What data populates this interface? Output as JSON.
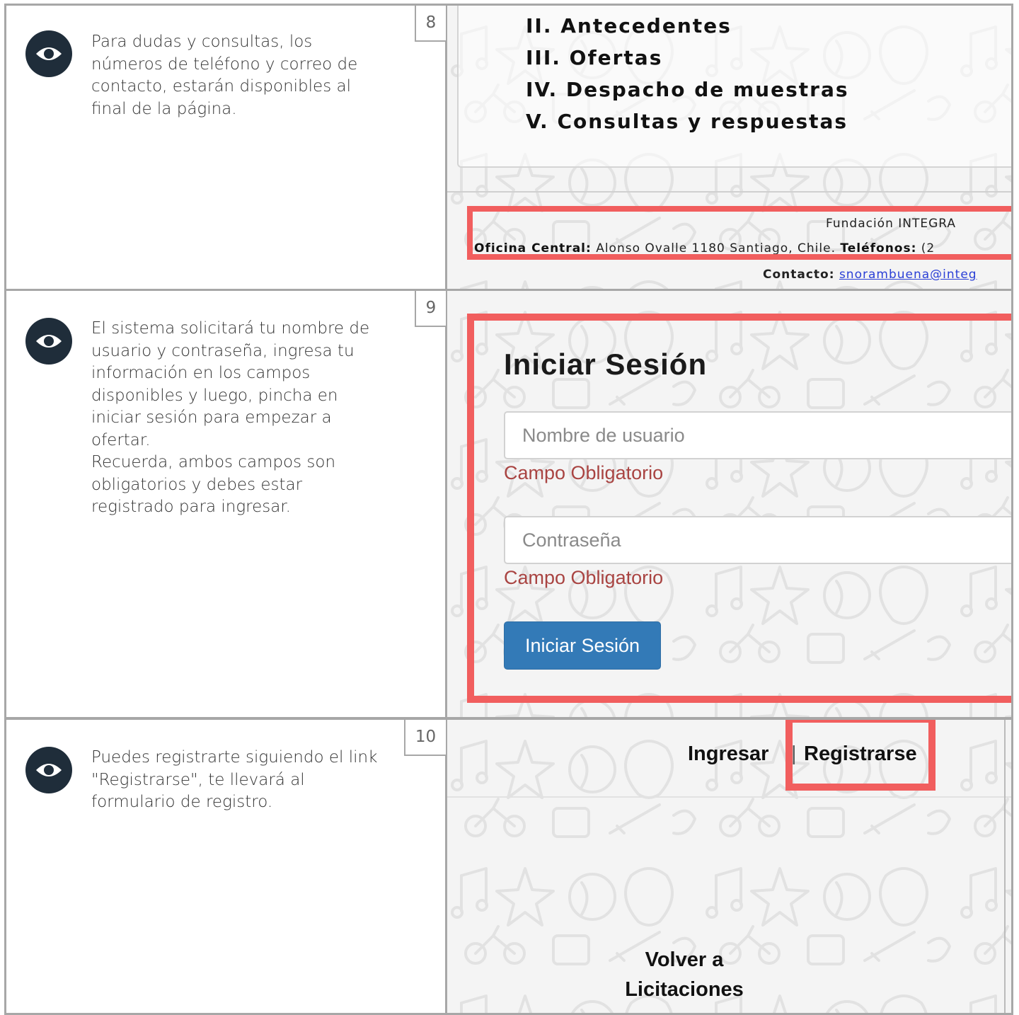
{
  "steps": [
    {
      "number": "8",
      "description": "Para dudas y consultas, los números de teléfono y correo de contacto, estarán disponibles al final de la página."
    },
    {
      "number": "9",
      "description": "El sistema solicitará tu nombre de usuario y contraseña, ingresa tu información en los campos disponibles y luego, pincha en iniciar sesión para empezar a ofertar.\nRecuerda, ambos campos son obligatorios y debes estar registrado para ingresar."
    },
    {
      "number": "10",
      "description": "Puedes registrarte siguiendo el link \"Registrarse\", te llevará al formulario de registro."
    }
  ],
  "screenshot8": {
    "toc": [
      "II. Antecedentes",
      "III. Ofertas",
      "IV. Despacho de muestras",
      "V. Consultas y respuestas"
    ],
    "footer": {
      "org": "Fundación INTEGRA",
      "office_label": "Oficina Central:",
      "office_value": "Alonso Ovalle 1180 Santiago, Chile.",
      "phones_label": "Teléfonos:",
      "phones_value": "(2",
      "contact_label": "Contacto:",
      "contact_value": "snorambuena@integ"
    }
  },
  "screenshot9": {
    "title": "Iniciar Sesión",
    "username_placeholder": "Nombre de usuario",
    "password_placeholder": "Contraseña",
    "required_1": "Campo Obligatorio",
    "required_2": "Campo Obligatorio",
    "button_label": "Iniciar Sesión"
  },
  "screenshot10": {
    "nav_login": "Ingresar",
    "nav_divider": "|",
    "nav_register": "Registrarse",
    "back_link": "Volver a Licitaciones"
  },
  "colors": {
    "highlight": "#f15e5e",
    "primary_button": "#337ab7",
    "required_text": "#a94442",
    "eye_badge": "#1f2d3a"
  },
  "icons": {
    "step": "eye-icon"
  }
}
